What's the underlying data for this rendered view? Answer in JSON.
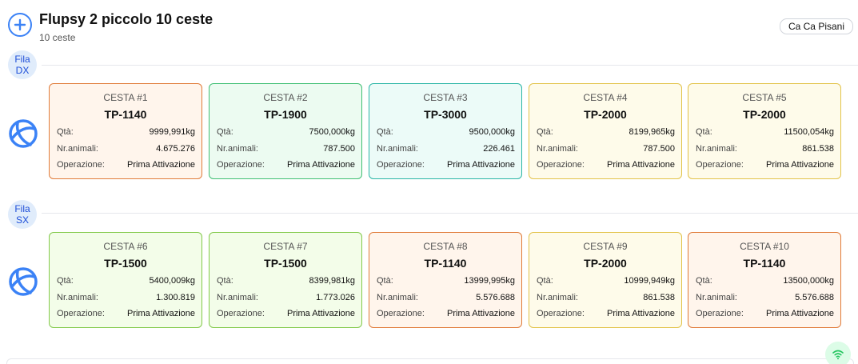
{
  "header": {
    "title": "Flupsy 2 piccolo 10 ceste",
    "subtitle": "10 ceste",
    "location": "Ca Ca Pisani"
  },
  "labels": {
    "qta": "Qtà:",
    "animali": "Nr.animali:",
    "operazione": "Operazione:"
  },
  "rows": [
    {
      "label": "Fila DX",
      "baskets": [
        {
          "name": "CESTA #1",
          "size": "TP-1140",
          "qta": "9999,991kg",
          "animali": "4.675.276",
          "operazione": "Prima Attivazione",
          "color": "#e07b39"
        },
        {
          "name": "CESTA #2",
          "size": "TP-1900",
          "qta": "7500,000kg",
          "animali": "787.500",
          "operazione": "Prima Attivazione",
          "color": "#3fbf73"
        },
        {
          "name": "CESTA #3",
          "size": "TP-3000",
          "qta": "9500,000kg",
          "animali": "226.461",
          "operazione": "Prima Attivazione",
          "color": "#2bb6a6"
        },
        {
          "name": "CESTA #4",
          "size": "TP-2000",
          "qta": "8199,965kg",
          "animali": "787.500",
          "operazione": "Prima Attivazione",
          "color": "#e2c34a"
        },
        {
          "name": "CESTA #5",
          "size": "TP-2000",
          "qta": "11500,054kg",
          "animali": "861.538",
          "operazione": "Prima Attivazione",
          "color": "#e2c34a"
        }
      ]
    },
    {
      "label": "Fila SX",
      "baskets": [
        {
          "name": "CESTA #6",
          "size": "TP-1500",
          "qta": "5400,009kg",
          "animali": "1.300.819",
          "operazione": "Prima Attivazione",
          "color": "#82c94a"
        },
        {
          "name": "CESTA #7",
          "size": "TP-1500",
          "qta": "8399,981kg",
          "animali": "1.773.026",
          "operazione": "Prima Attivazione",
          "color": "#82c94a"
        },
        {
          "name": "CESTA #8",
          "size": "TP-1140",
          "qta": "13999,995kg",
          "animali": "5.576.688",
          "operazione": "Prima Attivazione",
          "color": "#e07b39"
        },
        {
          "name": "CESTA #9",
          "size": "TP-2000",
          "qta": "10999,949kg",
          "animali": "861.538",
          "operazione": "Prima Attivazione",
          "color": "#e2c34a"
        },
        {
          "name": "CESTA #10",
          "size": "TP-1140",
          "qta": "13500,000kg",
          "animali": "5.576.688",
          "operazione": "Prima Attivazione",
          "color": "#e07b39"
        }
      ]
    }
  ],
  "icons": {
    "add": "plus-circle-icon",
    "row": "globe-icon",
    "status": "wifi-icon"
  },
  "colors": {
    "accent": "#3b82f6",
    "row_label_bg": "#e0ecfb",
    "online": "#22c55e"
  }
}
